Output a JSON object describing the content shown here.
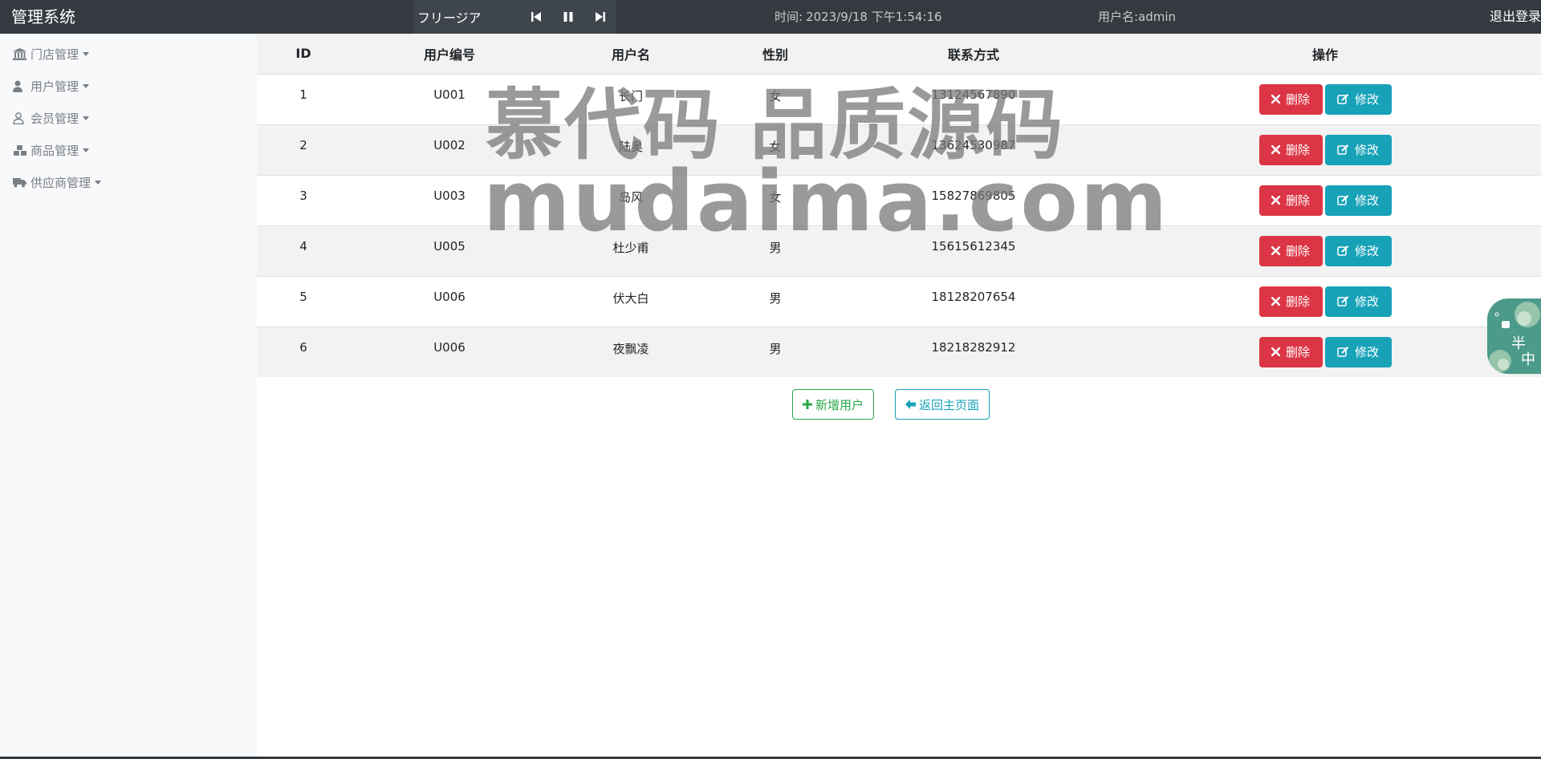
{
  "navbar": {
    "brand": "管理系统",
    "player": {
      "song": "フリージア"
    },
    "time_label": "时间:",
    "time_value": "2023/9/18 下午1:54:16",
    "username": "用户名:admin",
    "logout": "退出登录"
  },
  "sidebar": {
    "items": [
      {
        "label": "门店管理",
        "icon": "bank-icon"
      },
      {
        "label": "用户管理",
        "icon": "user-icon"
      },
      {
        "label": "会员管理",
        "icon": "member-icon"
      },
      {
        "label": "商品管理",
        "icon": "cubes-icon"
      },
      {
        "label": "供应商管理",
        "icon": "truck-icon"
      }
    ]
  },
  "table": {
    "headers": [
      "ID",
      "用户编号",
      "用户名",
      "性别",
      "联系方式",
      "操作"
    ],
    "rows": [
      {
        "id": "1",
        "code": "U001",
        "name": "长门",
        "gender": "女",
        "phone": "13124567890"
      },
      {
        "id": "2",
        "code": "U002",
        "name": "陆奥",
        "gender": "女",
        "phone": "13624530987"
      },
      {
        "id": "3",
        "code": "U003",
        "name": "岛风",
        "gender": "女",
        "phone": "15827869805"
      },
      {
        "id": "4",
        "code": "U005",
        "name": "杜少甫",
        "gender": "男",
        "phone": "15615612345"
      },
      {
        "id": "5",
        "code": "U006",
        "name": "伏大白",
        "gender": "男",
        "phone": "18128207654"
      },
      {
        "id": "6",
        "code": "U006",
        "name": "夜飘凌",
        "gender": "男",
        "phone": "18218282912"
      }
    ],
    "delete_label": "删除",
    "edit_label": "修改"
  },
  "actions": {
    "add_label": "新增用户",
    "back_label": "返回主页面"
  },
  "watermark": {
    "line1": "慕代码 品质源码",
    "line2": "mudaima.com"
  },
  "widget": {
    "text1": "半",
    "text2": "中"
  },
  "colors": {
    "navbar": "#343a40",
    "danger": "#dc3545",
    "info": "#17a2b8",
    "success": "#28a745",
    "sidebar_bg": "#f8f9fa"
  }
}
